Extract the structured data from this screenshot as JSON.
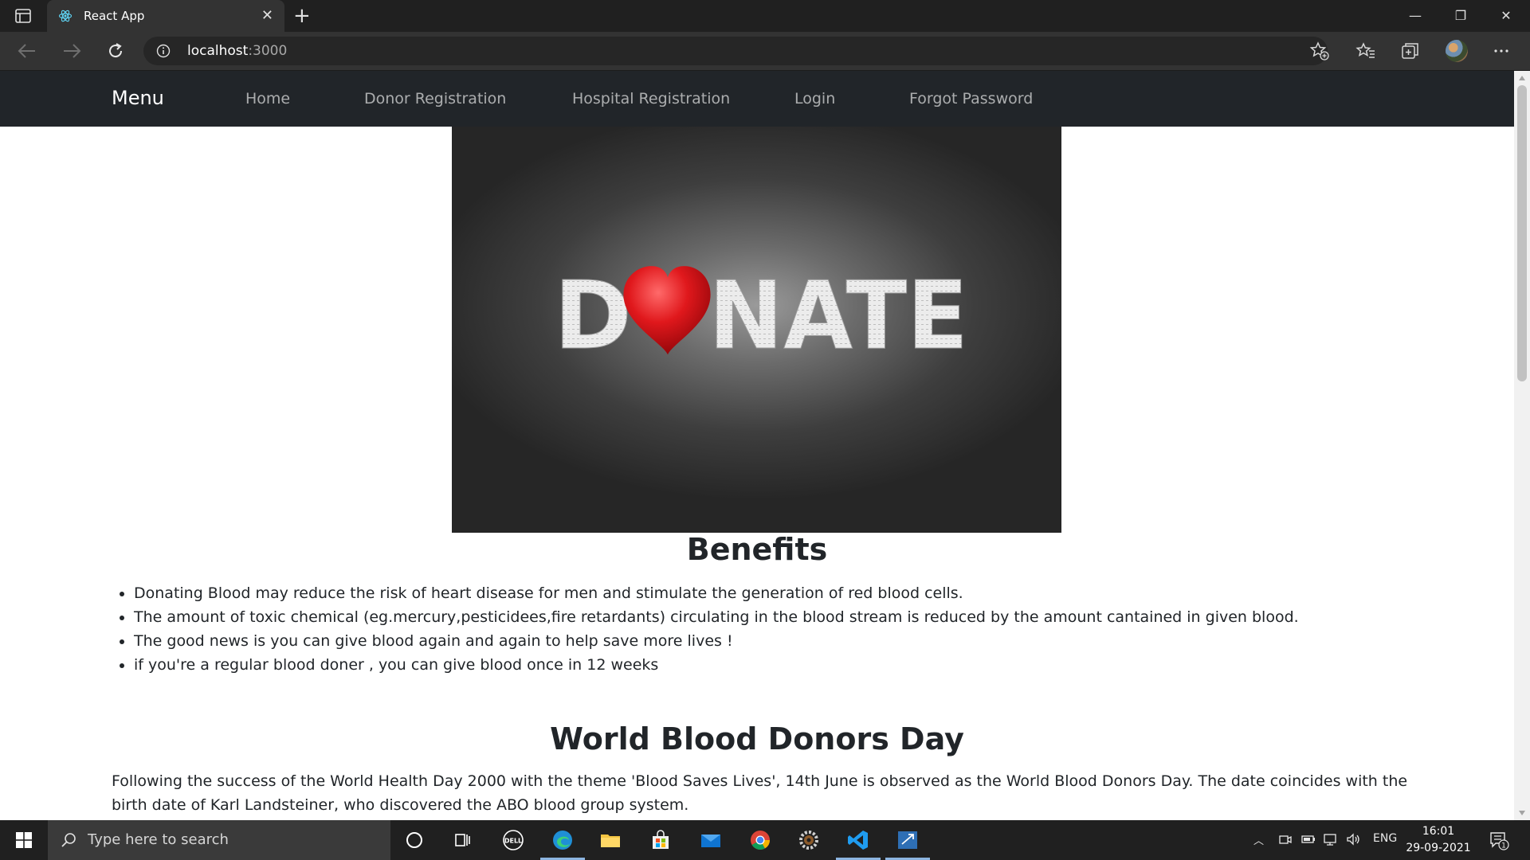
{
  "browser": {
    "tab_title": "React App",
    "new_tab_glyph": "+",
    "close_glyph": "✕",
    "url_host": "localhost",
    "url_port": ":3000",
    "window_controls": {
      "minimize": "—",
      "restore": "❐",
      "close": "✕"
    }
  },
  "navbar": {
    "brand": "Menu",
    "links": [
      "Home",
      "Donor Registration",
      "Hospital Registration",
      "Login",
      "Forgot Password"
    ]
  },
  "hero": {
    "letters_left": "D",
    "letters_right": "NATE",
    "heart_color": "#e0181c"
  },
  "benefits": {
    "heading": "Benefits",
    "items": [
      "Donating Blood may reduce the risk of heart disease for men and stimulate the generation of red blood cells.",
      "The amount of toxic chemical (eg.mercury,pesticidees,fire retardants) circulating in the blood stream is reduced by the amount cantained in given blood.",
      "The good news is you can give blood again and again to help save more lives !",
      "if you're a regular blood doner , you can give blood once in 12 weeks"
    ]
  },
  "world_day": {
    "heading": "World Blood Donors Day",
    "text": "Following the success of the World Health Day 2000 with the theme 'Blood Saves Lives', 14th June is observed as the World Blood Donors Day. The date coincides with the birth date of Karl Landsteiner, who discovered the ABO blood group system."
  },
  "taskbar": {
    "search_placeholder": "Type here to search",
    "icons": [
      "cortana-icon",
      "task-view-icon",
      "dell-icon",
      "edge-icon",
      "file-explorer-icon",
      "store-icon",
      "mail-icon",
      "chrome-icon",
      "settings-gear-icon",
      "vscode-icon",
      "remote-desktop-icon"
    ],
    "language": "ENG",
    "time": "16:01",
    "date": "29-09-2021",
    "notification_count": "1"
  }
}
